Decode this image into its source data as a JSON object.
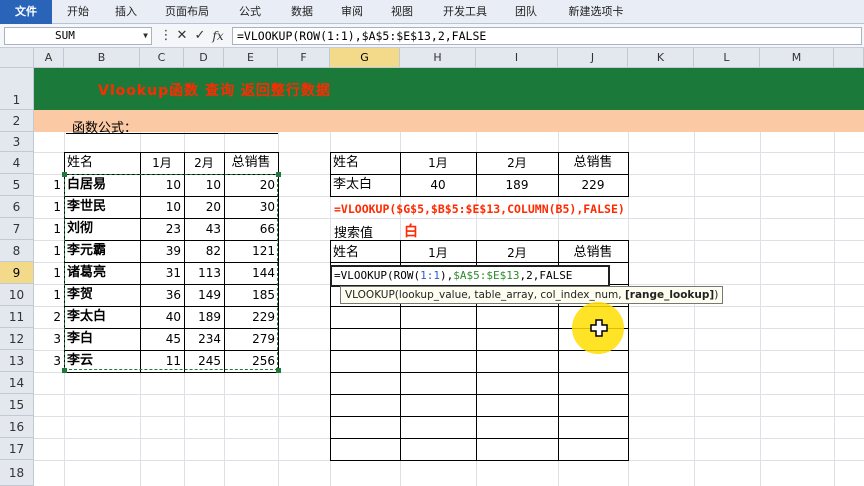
{
  "ribbon": {
    "tabs": [
      "文件",
      "开始",
      "插入",
      "页面布局",
      "公式",
      "数据",
      "审阅",
      "视图",
      "开发工具",
      "团队",
      "新建选项卡"
    ]
  },
  "formula_bar": {
    "name_box": "SUM",
    "formula_prefix": "=VLOOKUP(ROW(",
    "formula_row": "1:1",
    "formula_mid": "),",
    "formula_range": "$A$5:$E$13",
    "formula_suffix": ",2,FALSE"
  },
  "columns": [
    "A",
    "B",
    "C",
    "D",
    "E",
    "F",
    "G",
    "H",
    "I",
    "J",
    "K",
    "L",
    "M"
  ],
  "rows": [
    "1",
    "2",
    "3",
    "4",
    "5",
    "6",
    "7",
    "8",
    "9",
    "10",
    "11",
    "12",
    "13",
    "14",
    "15",
    "16",
    "17",
    "18"
  ],
  "sheet": {
    "title": "Vlookup函数  查询  返回整行数据",
    "formula_label": "函数公式：",
    "left_table": {
      "headers": [
        "姓名",
        "1月",
        "2月",
        "总销售"
      ],
      "rows": [
        {
          "a": "1",
          "name": "白居易",
          "m1": "10",
          "m2": "10",
          "total": "20"
        },
        {
          "a": "1",
          "name": "李世民",
          "m1": "10",
          "m2": "20",
          "total": "30"
        },
        {
          "a": "1",
          "name": "刘彻",
          "m1": "23",
          "m2": "43",
          "total": "66"
        },
        {
          "a": "1",
          "name": "李元霸",
          "m1": "39",
          "m2": "82",
          "total": "121"
        },
        {
          "a": "1",
          "name": "诸葛亮",
          "m1": "31",
          "m2": "113",
          "total": "144"
        },
        {
          "a": "1",
          "name": "李贺",
          "m1": "36",
          "m2": "149",
          "total": "185"
        },
        {
          "a": "2",
          "name": "李太白",
          "m1": "40",
          "m2": "189",
          "total": "229"
        },
        {
          "a": "3",
          "name": "李白",
          "m1": "45",
          "m2": "234",
          "total": "279"
        },
        {
          "a": "3",
          "name": "李云",
          "m1": "11",
          "m2": "245",
          "total": "256"
        }
      ]
    },
    "right_top": {
      "headers": [
        "姓名",
        "1月",
        "2月",
        "总销售"
      ],
      "row": [
        "李太白",
        "40",
        "189",
        "229"
      ]
    },
    "example_formula": "=VLOOKUP($G$5,$B$5:$E$13,COLUMN(B5),FALSE)",
    "search_label": "搜索值",
    "search_value": "白",
    "right_bottom": {
      "headers": [
        "姓名",
        "1月",
        "2月",
        "总销售"
      ]
    },
    "edit_cell": {
      "prefix": "=VLOOKUP(ROW(",
      "row_ref": "1:1",
      "mid": "),",
      "range": "$A$5:$E$13",
      "suffix": ",2,FALSE"
    },
    "tooltip": {
      "text": "VLOOKUP(lookup_value, table_array, col_index_num, ",
      "bold": "[range_lookup]",
      "end": ")"
    }
  },
  "colors": {
    "title_band": "#1b7a3a",
    "orange_band": "#fbcaa4",
    "accent_red": "#ff2a00",
    "selected_header": "#f3d98a"
  }
}
